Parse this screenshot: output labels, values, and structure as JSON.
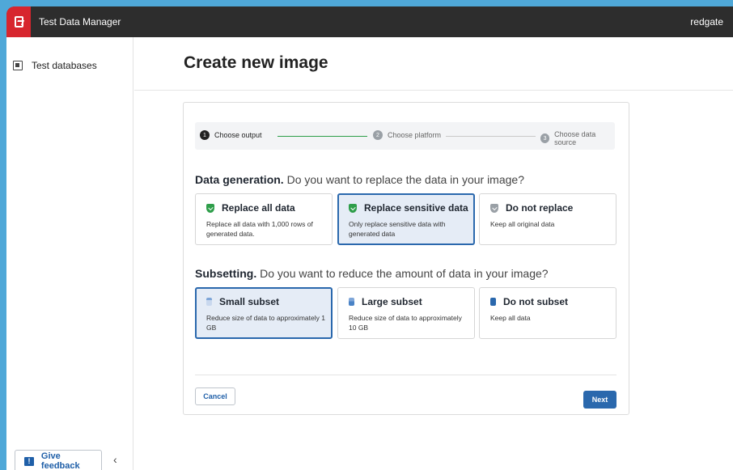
{
  "app": {
    "title": "Test Data Manager",
    "brand": "redgate"
  },
  "sidebar": {
    "items": [
      {
        "label": "Test databases"
      }
    ],
    "feedback_label": "Give feedback",
    "collapse_glyph": "‹"
  },
  "page": {
    "title": "Create new image"
  },
  "stepper": {
    "steps": [
      {
        "num": "1",
        "label": "Choose output",
        "state": "active"
      },
      {
        "num": "2",
        "label": "Choose platform",
        "state": "inactive"
      },
      {
        "num": "3",
        "label": "Choose data source",
        "state": "inactive"
      }
    ]
  },
  "data_generation": {
    "heading": "Data generation.",
    "question": "Do you want to replace the data in your image?",
    "options": [
      {
        "title": "Replace all data",
        "desc": "Replace all data with 1,000 rows of generated data.",
        "icon": "shield-check-icon",
        "selected": false
      },
      {
        "title": "Replace sensitive data",
        "desc": "Only replace sensitive data with generated data",
        "icon": "shield-check-icon",
        "selected": true
      },
      {
        "title": "Do not replace",
        "desc": "Keep all original data",
        "icon": "shield-icon",
        "selected": false
      }
    ]
  },
  "subsetting": {
    "heading": "Subsetting.",
    "question": "Do you want to reduce the amount of data in your image?",
    "options": [
      {
        "title": "Small subset",
        "desc": "Reduce size of data to approximately 1 GB",
        "icon": "database-small-icon",
        "selected": true
      },
      {
        "title": "Large subset",
        "desc": "Reduce size of data to approximately 10 GB",
        "icon": "database-large-icon",
        "selected": false
      },
      {
        "title": "Do not subset",
        "desc": "Keep all data",
        "icon": "database-full-icon",
        "selected": false
      }
    ]
  },
  "actions": {
    "cancel_label": "Cancel",
    "next_label": "Next"
  },
  "colors": {
    "accent": "#2a68ad",
    "brand_red": "#d7262e",
    "success": "#2e9e4a",
    "topbar": "#2d2d2d"
  }
}
